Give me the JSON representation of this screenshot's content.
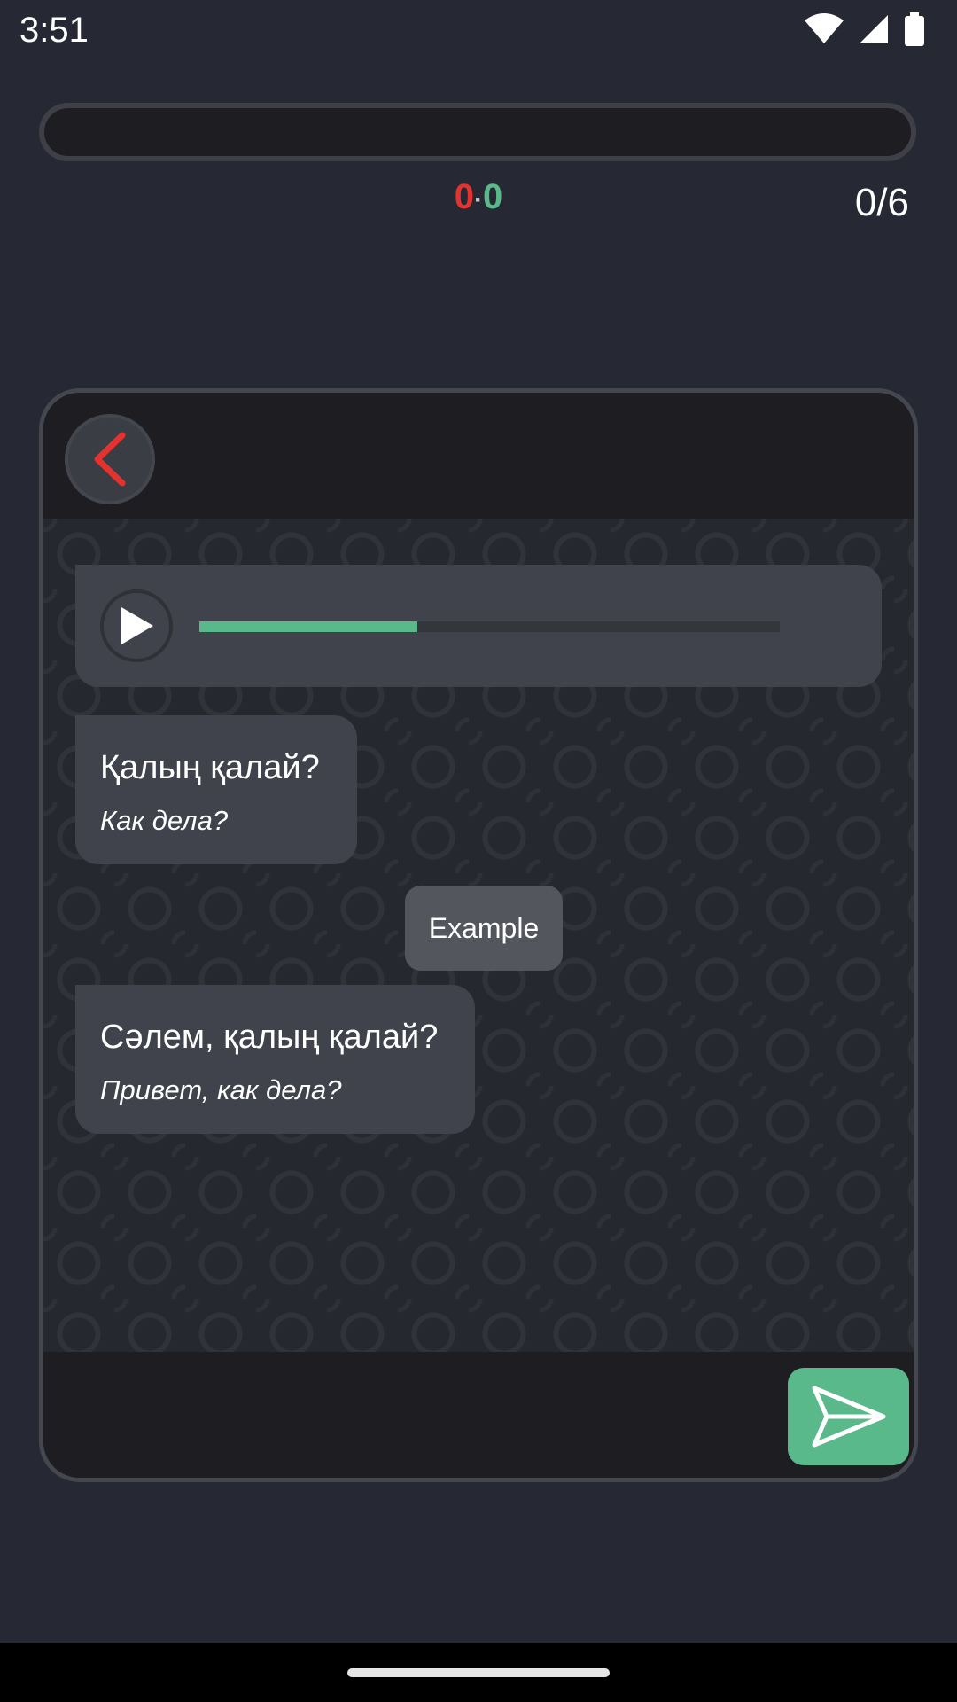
{
  "status_bar": {
    "time": "3:51",
    "icons": [
      "wifi-icon",
      "cell-signal-icon",
      "battery-icon"
    ]
  },
  "progress": {
    "fraction": 0
  },
  "score": {
    "wrong": "0",
    "separator": "·",
    "correct": "0",
    "wrong_color": "#e4332f",
    "correct_color": "#5ab98a"
  },
  "counter": "0/6",
  "card": {
    "back_icon": "chevron-left-icon",
    "audio": {
      "play_icon": "play-icon",
      "progress_fraction": 0.376
    },
    "messages": [
      {
        "text": "Қалың қалай?",
        "translation": "Как дела?"
      },
      {
        "text": "Сәлем, қалың қалай?",
        "translation": "Привет, как дела?"
      }
    ],
    "example_label": "Example",
    "send_icon": "send-icon"
  },
  "colors": {
    "accent_green": "#5ab98a",
    "accent_red": "#e4332f",
    "background": "#262833",
    "bubble": "#40434b"
  }
}
